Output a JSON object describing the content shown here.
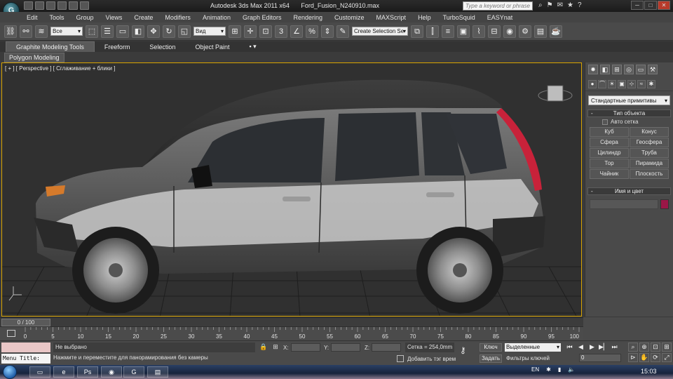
{
  "titlebar": {
    "app_title": "Autodesk 3ds Max  2011 x64",
    "file_name": "Ford_Fusion_N240910.max",
    "search_placeholder": "Type a keyword or phrase"
  },
  "menu": [
    "Edit",
    "Tools",
    "Group",
    "Views",
    "Create",
    "Modifiers",
    "Animation",
    "Graph Editors",
    "Rendering",
    "Customize",
    "MAXScript",
    "Help",
    "TurboSquid",
    "EASYnat"
  ],
  "toolbar": {
    "filter_value": "Все",
    "refcoord_value": "Вид",
    "selection_set_placeholder": "Create Selection Se"
  },
  "ribbon": {
    "tabs": [
      "Graphite Modeling Tools",
      "Freeform",
      "Selection",
      "Object Paint"
    ],
    "panel_label": "Polygon Modeling"
  },
  "viewport": {
    "label": "[ + ] [ Perspective ] [ Сглаживание + блики ]"
  },
  "command_panel": {
    "category_value": "Стандартные примитивы",
    "object_type_title": "Тип объекта",
    "autogrid_label": "Авто сетка",
    "object_buttons": [
      "Куб",
      "Конус",
      "Сфера",
      "Геосфера",
      "Цилиндр",
      "Труба",
      "Тор",
      "Пирамида",
      "Чайник",
      "Плоскость"
    ],
    "name_color_title": "Имя и цвет",
    "object_color": "#9b1747"
  },
  "timeline": {
    "slider_label": "0 / 100",
    "ticks": [
      "0",
      "5",
      "10",
      "15",
      "20",
      "25",
      "30",
      "35",
      "40",
      "45",
      "50",
      "55",
      "60",
      "65",
      "70",
      "75",
      "80",
      "85",
      "90",
      "95",
      "100"
    ]
  },
  "status": {
    "menu_title": "Menu Title:",
    "selection_text": "Не выбрано",
    "prompt_text": "Нажмите и переместите для панорамирования без камеры",
    "x_label": "X:",
    "y_label": "Y:",
    "z_label": "Z:",
    "grid_text": "Сетка = 254,0mm",
    "add_tag": "Добавить тэг врем",
    "key_label": "Ключ",
    "set_label": "Задать",
    "key_mode_value": "Выделенные",
    "key_filters": "Фильтры ключей",
    "current_frame": "0"
  },
  "taskbar": {
    "language": "EN",
    "clock": "15:03"
  }
}
